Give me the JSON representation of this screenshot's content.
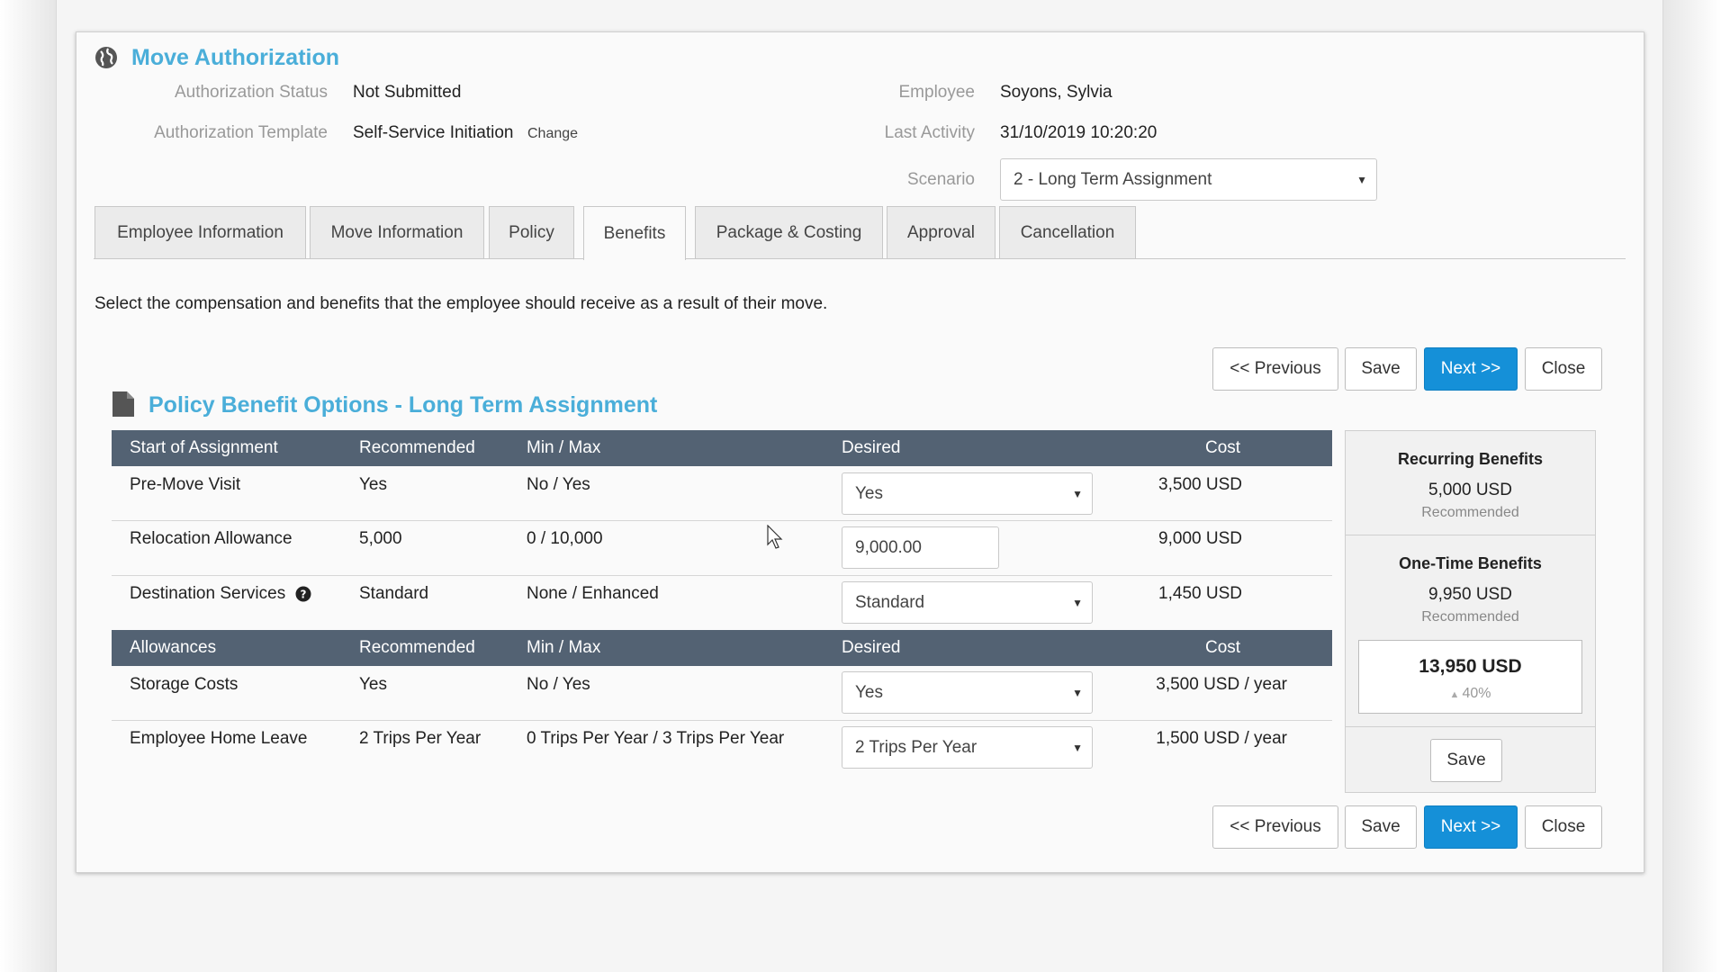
{
  "header": {
    "title": "Move Authorization",
    "auth_status_label": "Authorization Status",
    "auth_status_value": "Not Submitted",
    "auth_template_label": "Authorization Template",
    "auth_template_value": "Self-Service Initiation",
    "change_link": "Change",
    "employee_label": "Employee",
    "employee_value": "Soyons, Sylvia",
    "last_activity_label": "Last Activity",
    "last_activity_value": "31/10/2019 10:20:20",
    "scenario_label": "Scenario",
    "scenario_value": "2 - Long Term Assignment"
  },
  "tabs": [
    {
      "label": "Employee Information"
    },
    {
      "label": "Move Information"
    },
    {
      "label": "Policy"
    },
    {
      "label": "Benefits",
      "active": true
    },
    {
      "label": "Package & Costing"
    },
    {
      "label": "Approval"
    },
    {
      "label": "Cancellation"
    }
  ],
  "description": "Select the compensation and benefits that the employee should receive as a result of their move.",
  "nav": {
    "previous": "<< Previous",
    "save": "Save",
    "next": "Next >>",
    "close": "Close"
  },
  "section_title": "Policy Benefit Options - Long Term Assignment",
  "groups": [
    {
      "headers": [
        "Start of Assignment",
        "Recommended",
        "Min / Max",
        "Desired",
        "Cost"
      ],
      "rows": [
        {
          "name": "Pre-Move Visit",
          "recommended": "Yes",
          "minmax": "No / Yes",
          "desired": "Yes",
          "desired_type": "select",
          "cost": "3,500 USD"
        },
        {
          "name": "Relocation Allowance",
          "recommended": "5,000",
          "minmax": "0 / 10,000",
          "desired": "9,000.00",
          "desired_type": "input",
          "cost": "9,000 USD"
        },
        {
          "name": "Destination Services",
          "recommended": "Standard",
          "minmax": "None / Enhanced",
          "desired": "Standard",
          "desired_type": "select",
          "cost": "1,450 USD",
          "help_icon": "question-circle-icon"
        }
      ]
    },
    {
      "headers": [
        "Allowances",
        "Recommended",
        "Min / Max",
        "Desired",
        "Cost"
      ],
      "rows": [
        {
          "name": "Storage Costs",
          "recommended": "Yes",
          "minmax": "No / Yes",
          "desired": "Yes",
          "desired_type": "select",
          "cost": "3,500 USD / year"
        },
        {
          "name": "Employee Home Leave",
          "recommended": "2 Trips Per Year",
          "minmax": "0 Trips Per Year / 3 Trips Per Year",
          "desired": "2 Trips Per Year",
          "desired_type": "select",
          "cost": "1,500 USD / year"
        }
      ]
    }
  ],
  "summary": {
    "recurring_title": "Recurring Benefits",
    "recurring_value": "5,000 USD",
    "recurring_note": "Recommended",
    "onetime_title": "One-Time Benefits",
    "onetime_value": "9,950 USD",
    "onetime_note": "Recommended",
    "total_value": "13,950 USD",
    "total_change": "40%",
    "save": "Save"
  },
  "colors": {
    "accent": "#4aaed9",
    "primary_button": "#1590d8",
    "table_header": "#536273"
  }
}
